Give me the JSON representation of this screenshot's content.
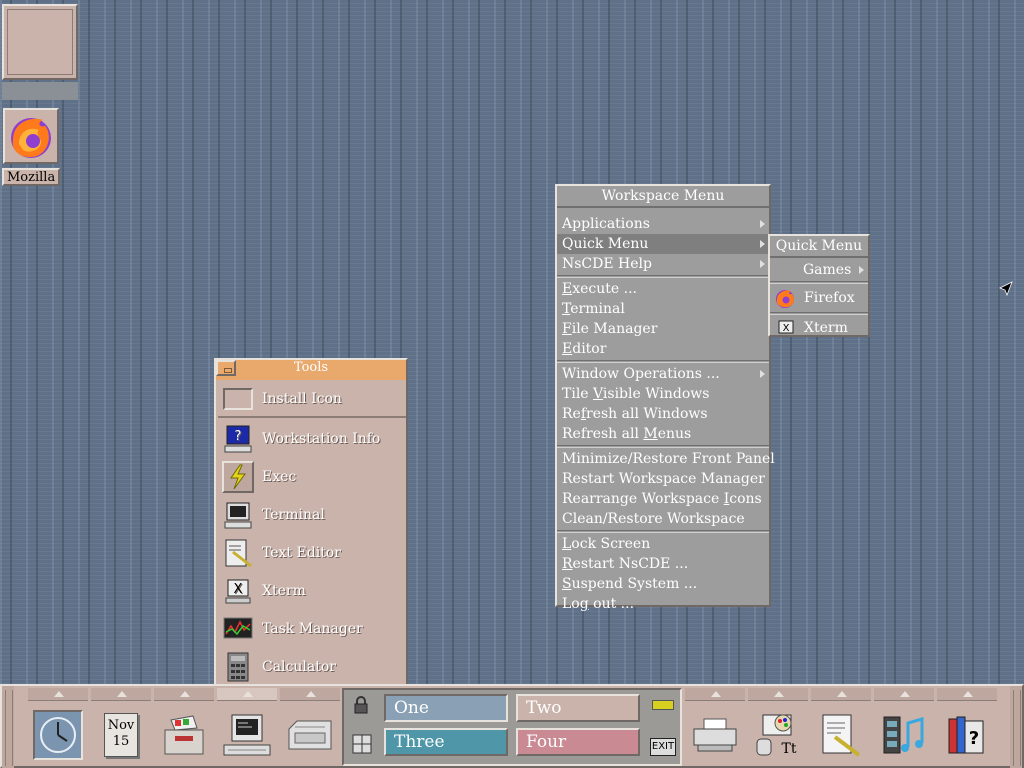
{
  "desktop": {
    "icons": [
      {
        "label": "Mozilla",
        "icon": "firefox-icon"
      }
    ]
  },
  "tools_panel": {
    "title": "Tools",
    "items": [
      {
        "label": "Install Icon",
        "icon": "install-icon"
      },
      {
        "label": "Workstation Info",
        "icon": "workstation-info-icon"
      },
      {
        "label": "Exec",
        "icon": "lightning-icon"
      },
      {
        "label": "Terminal",
        "icon": "terminal-icon"
      },
      {
        "label": "Text Editor",
        "icon": "text-editor-icon"
      },
      {
        "label": "Xterm",
        "icon": "xterm-icon"
      },
      {
        "label": "Task Manager",
        "icon": "task-manager-icon"
      },
      {
        "label": "Calculator",
        "icon": "calculator-icon"
      }
    ]
  },
  "workspace_menu": {
    "title": "Workspace Menu",
    "groups": [
      [
        {
          "label": "Applications",
          "submenu": true
        },
        {
          "label": "Quick Menu",
          "submenu": true,
          "selected": true
        },
        {
          "label": "NsCDE Help",
          "submenu": true
        }
      ],
      [
        {
          "pre": "",
          "u": "E",
          "post": "xecute ..."
        },
        {
          "pre": "",
          "u": "T",
          "post": "erminal"
        },
        {
          "pre": "",
          "u": "F",
          "post": "ile Manager"
        },
        {
          "pre": "",
          "u": "E",
          "post": "ditor"
        }
      ],
      [
        {
          "pre": "Window Operations ...",
          "u": "",
          "post": "",
          "submenu": true
        },
        {
          "pre": "Tile ",
          "u": "V",
          "post": "isible Windows"
        },
        {
          "pre": "Re",
          "u": "f",
          "post": "resh all Windows"
        },
        {
          "pre": "Refresh all ",
          "u": "M",
          "post": "enus"
        }
      ],
      [
        {
          "pre": "Minimize/Restore Front Panel",
          "u": "",
          "post": ""
        },
        {
          "pre": "Restart Workspace Manager",
          "u": "",
          "post": ""
        },
        {
          "pre": "Rearrange Workspace ",
          "u": "I",
          "post": "cons"
        },
        {
          "pre": "Clean/Restore Workspace",
          "u": "",
          "post": ""
        }
      ],
      [
        {
          "pre": "",
          "u": "L",
          "post": "ock Screen"
        },
        {
          "pre": "",
          "u": "R",
          "post": "estart NsCDE ..."
        },
        {
          "pre": "",
          "u": "S",
          "post": "uspend System ..."
        },
        {
          "pre": "Lo",
          "u": "g",
          "post": " out ..."
        }
      ]
    ]
  },
  "quick_menu": {
    "title": "Quick Menu",
    "items": [
      {
        "label": "Games",
        "submenu": true
      },
      {
        "label": "Firefox",
        "icon": "firefox-icon"
      },
      {
        "label": "Xterm",
        "icon": "xterm-icon"
      }
    ]
  },
  "front_panel": {
    "calendar": {
      "month": "Nov",
      "day": "15"
    },
    "workspaces": [
      {
        "label": "One",
        "color": "#8aa1b5"
      },
      {
        "label": "Two",
        "color": "#c9b3aa"
      },
      {
        "label": "Three",
        "color": "#4f97a8"
      },
      {
        "label": "Four",
        "color": "#c98a93"
      }
    ],
    "exit_label": "EXIT"
  }
}
